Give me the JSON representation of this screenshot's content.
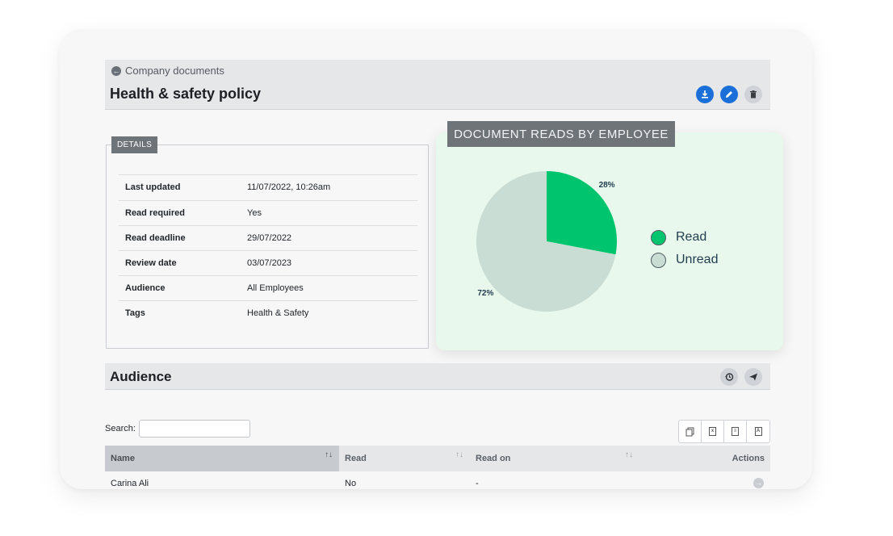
{
  "breadcrumb": {
    "label": "Company documents",
    "icon": "arrow-left-circle-icon"
  },
  "document": {
    "title": "Health & safety policy"
  },
  "header_actions": [
    {
      "name": "download",
      "icon": "download-icon",
      "color": "#1b6fd8"
    },
    {
      "name": "edit",
      "icon": "pencil-icon",
      "color": "#1b6fd8"
    },
    {
      "name": "delete",
      "icon": "trash-icon",
      "color": "#cfd2d6"
    }
  ],
  "details": {
    "tab_label": "DETAILS",
    "rows": [
      {
        "key": "Last updated",
        "value": "11/07/2022, 10:26am"
      },
      {
        "key": "Read required",
        "value": "Yes"
      },
      {
        "key": "Read deadline",
        "value": "29/07/2022"
      },
      {
        "key": "Review date",
        "value": "03/07/2023"
      },
      {
        "key": "Audience",
        "value": "All Employees"
      },
      {
        "key": "Tags",
        "value": "Health & Safety"
      }
    ]
  },
  "chart_data": {
    "type": "pie",
    "title": "DOCUMENT READS BY EMPLOYEE",
    "categories": [
      "Read",
      "Unread"
    ],
    "values": [
      28,
      72
    ],
    "labels": [
      "28%",
      "72%"
    ],
    "colors": [
      "#00c46e",
      "#c9ddd5"
    ],
    "legend_position": "right"
  },
  "audience": {
    "title": "Audience",
    "actions": [
      {
        "name": "history",
        "icon": "history-icon"
      },
      {
        "name": "send",
        "icon": "send-icon"
      }
    ],
    "search_label": "Search:",
    "search_value": "",
    "exports": [
      {
        "name": "copy",
        "icon": "copy-icon"
      },
      {
        "name": "excel",
        "icon": "excel-icon"
      },
      {
        "name": "csv",
        "icon": "csv-icon"
      },
      {
        "name": "pdf",
        "icon": "pdf-icon"
      }
    ],
    "columns": [
      "Name",
      "Read",
      "Read on",
      "Actions"
    ],
    "rows": [
      {
        "name": "Carina Ali",
        "read": "No",
        "read_on": "-"
      }
    ]
  }
}
